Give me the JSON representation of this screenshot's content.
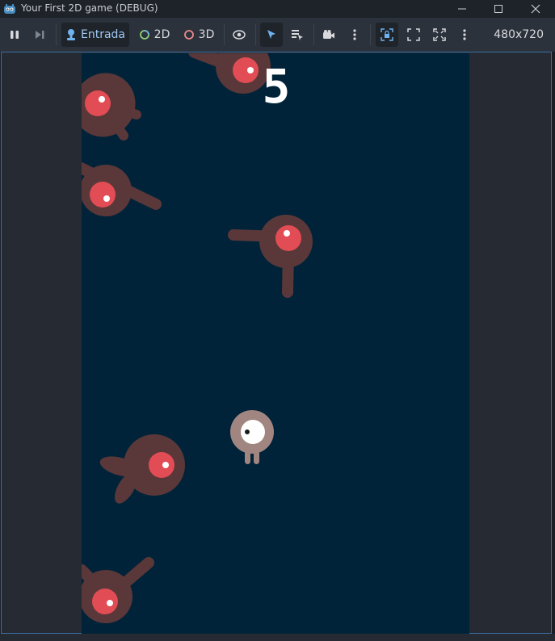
{
  "window": {
    "title": "Your First 2D game (DEBUG)"
  },
  "toolbar": {
    "input_label": "Entrada",
    "mode_2d_label": "2D",
    "mode_3d_label": "3D",
    "resolution": "480x720"
  },
  "game": {
    "score": "5"
  },
  "colors": {
    "game_background": "#012339",
    "mob_body": "#5a3839",
    "mob_eye": "#e24c54",
    "player_body": "#a08581",
    "accent": "#3b6ea5"
  }
}
